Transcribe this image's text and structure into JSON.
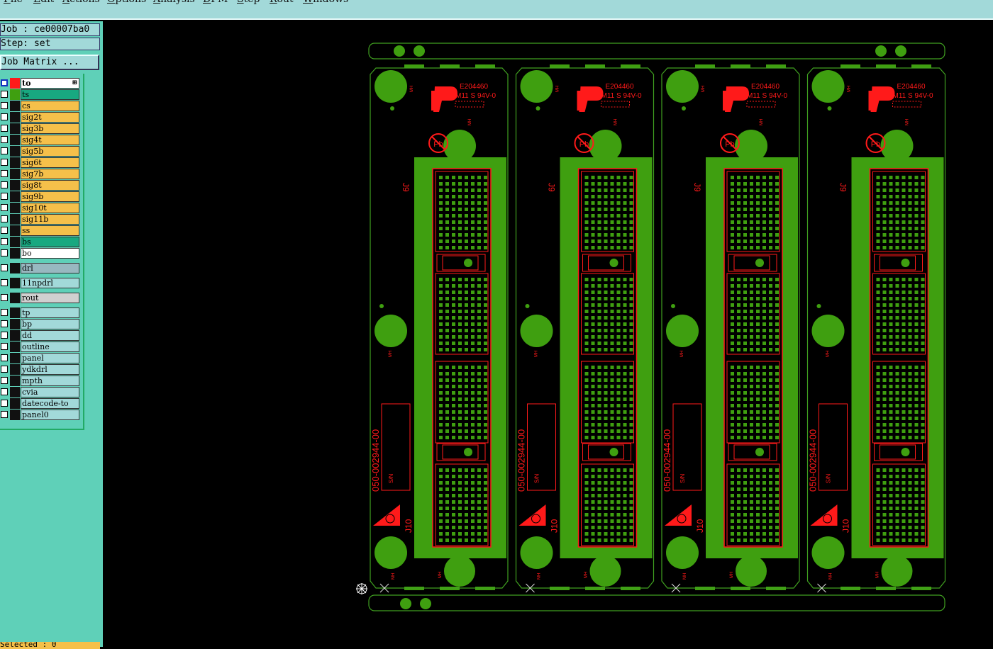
{
  "menu": [
    "File",
    "Edit",
    "Actions",
    "Options",
    "Analysis",
    "DFM",
    "Step",
    "Rout",
    "Windows"
  ],
  "menu_mnemonics": [
    "F",
    "E",
    "A",
    "O",
    "A",
    "D",
    "S",
    "R",
    "W"
  ],
  "info": {
    "job": "Job : ce00007ba0",
    "step": "Step: set",
    "matrix_button": "Job Matrix ..."
  },
  "layers": [
    {
      "name": "to",
      "bg": "#ffffff",
      "color": "#ff1a1a",
      "checked": true,
      "mark": "⊞"
    },
    {
      "name": "ts",
      "bg": "#18a880",
      "color": "#3f9f10"
    },
    {
      "name": "cs",
      "bg": "#f5c04a"
    },
    {
      "name": "sig2t",
      "bg": "#f5c04a"
    },
    {
      "name": "sig3b",
      "bg": "#f5c04a"
    },
    {
      "name": "sig4t",
      "bg": "#f5c04a"
    },
    {
      "name": "sig5b",
      "bg": "#f5c04a"
    },
    {
      "name": "sig6t",
      "bg": "#f5c04a"
    },
    {
      "name": "sig7b",
      "bg": "#f5c04a"
    },
    {
      "name": "sig8t",
      "bg": "#f5c04a"
    },
    {
      "name": "sig9b",
      "bg": "#f5c04a"
    },
    {
      "name": "sig10t",
      "bg": "#f5c04a"
    },
    {
      "name": "sig11b",
      "bg": "#f5c04a"
    },
    {
      "name": "ss",
      "bg": "#f5c04a"
    },
    {
      "name": "bs",
      "bg": "#18a880"
    },
    {
      "name": "bo",
      "bg": "#ffffff"
    },
    {
      "name": "drl",
      "bg": "#98b8c0",
      "group_gap": true
    },
    {
      "name": "11npdrl",
      "bg": "#a2d9d9",
      "group_gap": true
    },
    {
      "name": "rout",
      "bg": "#d0d0d0",
      "group_gap": true
    },
    {
      "name": "tp",
      "bg": "#a2d9d9",
      "group_gap": true
    },
    {
      "name": "bp",
      "bg": "#a2d9d9"
    },
    {
      "name": "dd",
      "bg": "#a2d9d9"
    },
    {
      "name": "outline",
      "bg": "#a2d9d9"
    },
    {
      "name": "panel",
      "bg": "#a2d9d9"
    },
    {
      "name": "ydkdrl",
      "bg": "#a2d9d9"
    },
    {
      "name": "mpth",
      "bg": "#a2d9d9"
    },
    {
      "name": "cvia",
      "bg": "#a2d9d9"
    },
    {
      "name": "datecode-to",
      "bg": "#a2d9d9"
    },
    {
      "name": "panel0",
      "bg": "#a2d9d9"
    }
  ],
  "status_text": "Selected : 0",
  "colors": {
    "copper": "#3f9f10",
    "silk": "#ff1a1a",
    "outline": "#40a020",
    "menubar": "#a2d9d9",
    "panel": "#5fd0b8"
  },
  "board": {
    "count": 4,
    "ul_code": "E204460",
    "material": "M11 S 94V-0",
    "part_number": "050-002944-00",
    "pb_mark": "Pb",
    "connector_top": "J9",
    "connector_bottom": "J10",
    "sn_label": "S/N",
    "mount_label": "MH"
  }
}
